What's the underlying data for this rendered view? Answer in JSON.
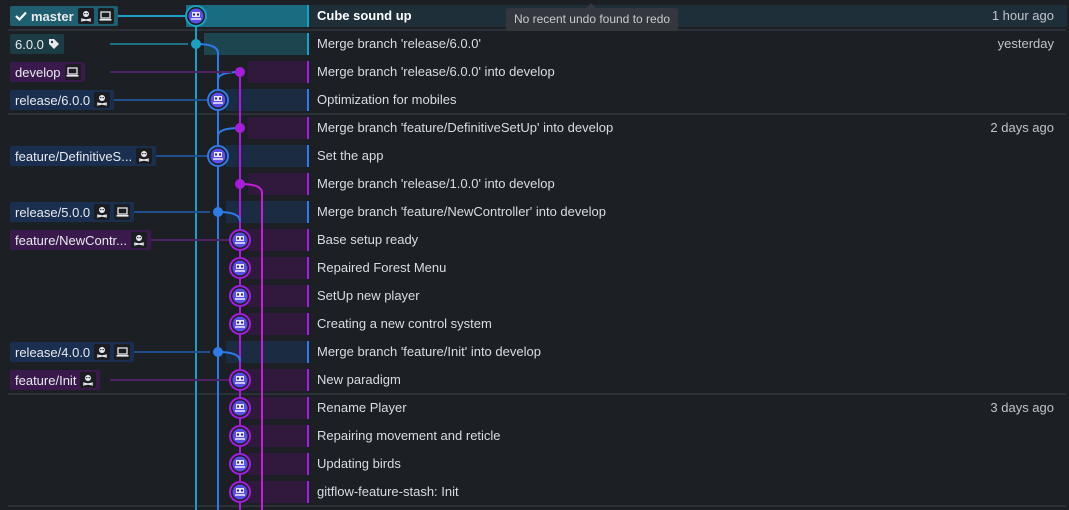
{
  "tooltip": "No recent undo found to redo",
  "colors": {
    "master": "#1aa1c2",
    "release": "#2e7be8",
    "develop": "#a71de0",
    "extra": "#c41fd6",
    "avatar": "#5b4fe8"
  },
  "commits": [
    {
      "message": "Cube sound up",
      "time": "1 hour ago",
      "selected": true,
      "refs": [
        {
          "label": "master",
          "kind": "master",
          "checked": true,
          "icons": [
            "gitflow-icon",
            "laptop-icon"
          ]
        }
      ]
    },
    {
      "message": "Merge branch 'release/6.0.0'",
      "time": "yesterday",
      "refs": [
        {
          "label": "6.0.0",
          "kind": "tag",
          "icons": [
            "tag-icon"
          ]
        }
      ]
    },
    {
      "message": "Merge branch 'release/6.0.0' into develop",
      "time": "",
      "refs": [
        {
          "label": "develop",
          "kind": "develop",
          "icons": [
            "laptop-icon"
          ]
        }
      ]
    },
    {
      "message": "Optimization for mobiles",
      "time": "",
      "refs": [
        {
          "label": "release/6.0.0",
          "kind": "release",
          "icons": [
            "gitflow-icon"
          ]
        }
      ]
    },
    {
      "message": "Merge branch 'feature/DefinitiveSetUp' into develop",
      "time": "2 days ago",
      "refs": []
    },
    {
      "message": "Set the app",
      "time": "",
      "refs": [
        {
          "label": "feature/DefinitiveS...",
          "kind": "release",
          "icons": [
            "gitflow-icon"
          ]
        }
      ]
    },
    {
      "message": "Merge branch 'release/1.0.0' into develop",
      "time": "",
      "refs": []
    },
    {
      "message": "Merge branch 'feature/NewController' into develop",
      "time": "",
      "refs": [
        {
          "label": "release/5.0.0",
          "kind": "release",
          "icons": [
            "gitflow-icon",
            "laptop-icon"
          ]
        }
      ]
    },
    {
      "message": "Base setup ready",
      "time": "",
      "refs": [
        {
          "label": "feature/NewContr...",
          "kind": "develop",
          "icons": [
            "gitflow-icon"
          ]
        }
      ]
    },
    {
      "message": "Repaired Forest Menu",
      "time": "",
      "refs": []
    },
    {
      "message": "SetUp new player",
      "time": "",
      "refs": []
    },
    {
      "message": "Creating a new control system",
      "time": "",
      "refs": []
    },
    {
      "message": "Merge branch 'feature/Init' into develop",
      "time": "",
      "refs": [
        {
          "label": "release/4.0.0",
          "kind": "release",
          "icons": [
            "gitflow-icon",
            "laptop-icon"
          ]
        }
      ]
    },
    {
      "message": "New paradigm",
      "time": "",
      "refs": [
        {
          "label": "feature/Init",
          "kind": "develop",
          "icons": [
            "gitflow-icon"
          ]
        }
      ]
    },
    {
      "message": "Rename Player",
      "time": "3 days ago",
      "refs": []
    },
    {
      "message": "Repairing movement and reticle",
      "time": "",
      "refs": []
    },
    {
      "message": "Updating birds",
      "time": "",
      "refs": []
    },
    {
      "message": "gitflow-feature-stash: Init",
      "time": "",
      "refs": []
    }
  ]
}
